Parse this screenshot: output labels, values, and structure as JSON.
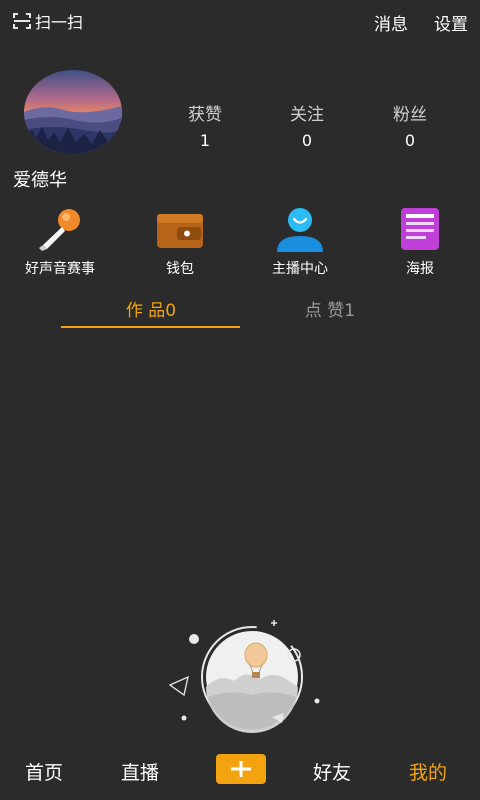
{
  "header": {
    "scan_label": "扫一扫",
    "messages_label": "消息",
    "settings_label": "设置"
  },
  "profile": {
    "username": "爱德华",
    "stats": [
      {
        "label": "获赞",
        "value": "1"
      },
      {
        "label": "关注",
        "value": "0"
      },
      {
        "label": "粉丝",
        "value": "0"
      }
    ]
  },
  "features": [
    {
      "label": "好声音赛事",
      "icon": "microphone-icon"
    },
    {
      "label": "钱包",
      "icon": "wallet-icon"
    },
    {
      "label": "主播中心",
      "icon": "anchor-user-icon"
    },
    {
      "label": "海报",
      "icon": "poster-icon"
    }
  ],
  "tabs": {
    "works_label": "作 品0",
    "likes_label": "点 赞1",
    "active": "works"
  },
  "bottom_nav": {
    "home": "首页",
    "live": "直播",
    "plus_icon": "plus-icon",
    "friends": "好友",
    "mine": "我的",
    "active": "mine"
  },
  "colors": {
    "background": "#2b2b2b",
    "accent": "#f3a30f",
    "inactive_tab": "#9a9a9a"
  }
}
